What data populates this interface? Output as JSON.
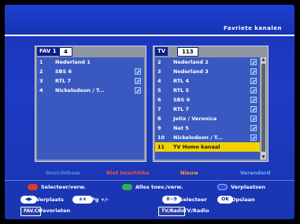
{
  "header": {
    "title": "Favriete kanalen"
  },
  "fav_panel": {
    "tag": "FAV 1",
    "count": "4",
    "items": [
      {
        "num": "1",
        "name": "Nederland 1"
      },
      {
        "num": "2",
        "name": "SBS 6"
      },
      {
        "num": "3",
        "name": "RTL 7"
      },
      {
        "num": "4",
        "name": "Nickelodeon / T..."
      }
    ]
  },
  "tv_panel": {
    "tag": "TV",
    "count": "113",
    "items": [
      {
        "num": "2",
        "name": "Nederland 2"
      },
      {
        "num": "3",
        "name": "Nederland 3"
      },
      {
        "num": "4",
        "name": "RTL 4"
      },
      {
        "num": "5",
        "name": "RTL 5"
      },
      {
        "num": "6",
        "name": "SBS 6"
      },
      {
        "num": "7",
        "name": "RTL 7"
      },
      {
        "num": "8",
        "name": "Jetix / Veronica"
      },
      {
        "num": "9",
        "name": "Net 5"
      },
      {
        "num": "10",
        "name": "Nickelodeon / T..."
      },
      {
        "num": "11",
        "name": "TV Homo kanaal"
      }
    ]
  },
  "legend": {
    "invisible": "Onzichtbaar",
    "unavailable": "Niet beschikba",
    "new": "Nieuw",
    "changed": "Veranderd",
    "colors": {
      "invisible": "#4f8fe6",
      "unavailable": "#ff4d3a",
      "new": "#ff9c2a",
      "changed": "#6fb1ff"
    }
  },
  "color_buttons": {
    "red_label": "Selecteer/verw.",
    "green_label": "Alles toev./verw.",
    "blue_label": "Verplaatsen"
  },
  "help": {
    "move_key": "◀▶",
    "move_label": "Verplaats",
    "page_key": "∧∨",
    "page_label": "Pg +/-",
    "digits_key": "0~9",
    "select_label": "Selecteer",
    "ok_key": "OK",
    "ok_label": "Opslaan",
    "favch_key": "FAV.CH",
    "favch_label": "Favorieten",
    "tvradio_key": "TV/Radio",
    "tvradio_label": "TV/Radio"
  }
}
